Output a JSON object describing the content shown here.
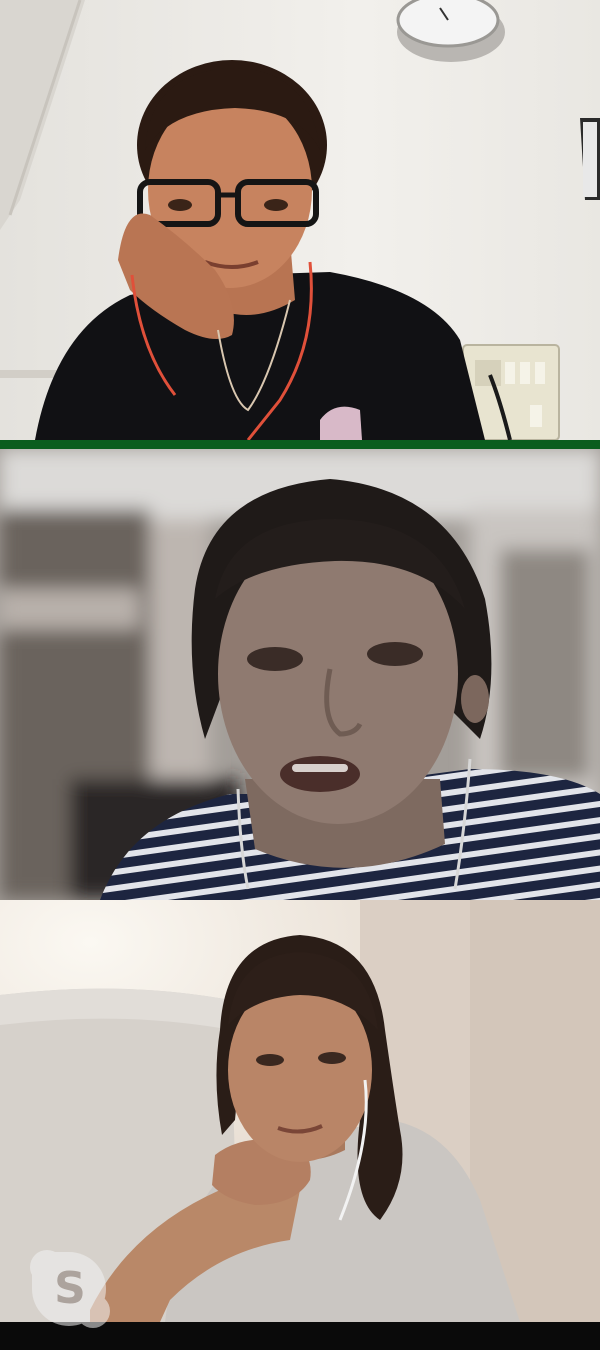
{
  "call": {
    "participants": [
      {
        "id": "participant-1",
        "active_speaker": true
      },
      {
        "id": "participant-2",
        "active_speaker": false
      },
      {
        "id": "participant-3",
        "active_speaker": false
      }
    ],
    "active_indicator_color": "#0b5d1e"
  },
  "branding": {
    "logo_icon": "skype-icon",
    "logo_letter": "S"
  }
}
